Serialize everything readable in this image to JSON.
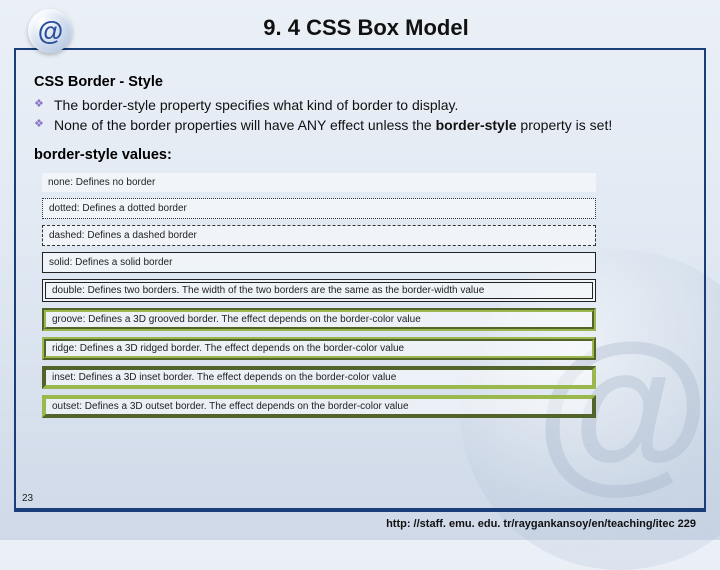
{
  "header": {
    "icon_glyph": "@",
    "title": "9. 4 CSS Box Model"
  },
  "section": {
    "title": "CSS Border - Style",
    "bullets": [
      "The border-style property specifies what kind of border to display.",
      "None of the border properties will have ANY effect unless the border-style property is set!"
    ],
    "bold_phrase": "border-style",
    "values_title": "border-style values:"
  },
  "samples": [
    {
      "cls": "s-none",
      "text": "none: Defines no border"
    },
    {
      "cls": "s-dotted",
      "text": "dotted: Defines a dotted border"
    },
    {
      "cls": "s-dashed",
      "text": "dashed: Defines a dashed border"
    },
    {
      "cls": "s-solid",
      "text": "solid: Defines a solid border"
    },
    {
      "cls": "s-double",
      "text": "double: Defines two borders. The width of the two borders are the same as the border-width value"
    },
    {
      "cls": "s-groove",
      "text": "groove: Defines a 3D grooved border. The effect depends on the border-color value"
    },
    {
      "cls": "s-ridge",
      "text": "ridge: Defines a 3D ridged border. The effect depends on the border-color value"
    },
    {
      "cls": "s-inset",
      "text": "inset: Defines a 3D inset border. The effect depends on the border-color value"
    },
    {
      "cls": "s-outset",
      "text": "outset: Defines a 3D outset border. The effect depends on the border-color value"
    }
  ],
  "page_number": "23",
  "footer_url": "http: //staff. emu. edu. tr/raygankansoy/en/teaching/itec 229"
}
